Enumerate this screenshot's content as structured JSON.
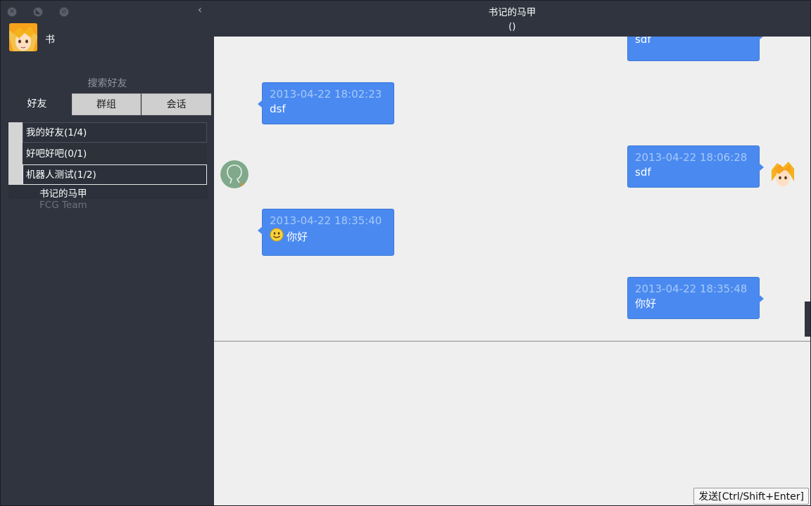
{
  "sidebar": {
    "username": "书",
    "search_label": "搜索好友",
    "tabs": [
      {
        "label": "好友"
      },
      {
        "label": "群组"
      },
      {
        "label": "会话"
      }
    ],
    "groups": [
      {
        "label": "我的好友(1/4)"
      },
      {
        "label": "好吧好吧(0/1)"
      },
      {
        "label": "机器人测试(1/2)"
      }
    ],
    "members": [
      {
        "name": "书记的马甲",
        "status": "online"
      },
      {
        "name": "FCG Team",
        "status": "offline"
      }
    ]
  },
  "chat": {
    "title": "书记的马甲",
    "subtitle": "()",
    "messages": [
      {
        "side": "right",
        "time": "",
        "text": "sdf"
      },
      {
        "side": "left",
        "time": "2013-04-22 18:02:23",
        "text": "dsf"
      },
      {
        "side": "right",
        "time": "2013-04-22 18:06:28",
        "text": "sdf"
      },
      {
        "side": "left",
        "time": "2013-04-22 18:35:40",
        "text": "你好",
        "emoji": "smiley-icon"
      },
      {
        "side": "right",
        "time": "2013-04-22 18:35:48",
        "text": "你好"
      }
    ],
    "send_label": "发送[Ctrl/Shift+Enter]"
  },
  "colors": {
    "sidebar_bg": "#2f343f",
    "bubble": "#4a8af0",
    "chat_bg": "#efefef"
  }
}
